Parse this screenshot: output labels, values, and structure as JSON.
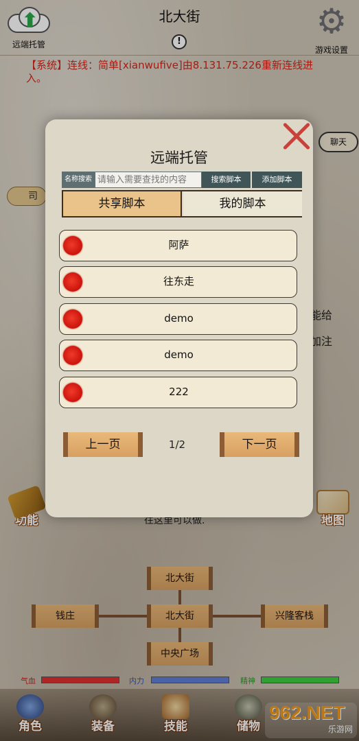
{
  "header": {
    "remote_label": "远端托管",
    "location": "北大街",
    "alert_symbol": "!",
    "settings_label": "游戏设置"
  },
  "system_message": "【系统】连线：简单[xianwufive]由8.131.75.226重新连线进入。",
  "background": {
    "chat_label": "聊天",
    "npc_tag": "司马",
    "line1": "能给",
    "line2": "加注",
    "line3": "往这里可以做.",
    "skills_label": "功能",
    "map_label": "地图"
  },
  "map": {
    "north": "北大街",
    "center": "北大街",
    "west": "钱庄",
    "east": "兴隆客栈",
    "south": "中央广场"
  },
  "stats": {
    "hp_label": "气血",
    "mp_label": "内力",
    "sp_label": "精神",
    "hp_color": "#e03030",
    "mp_color": "#5f7fd8",
    "sp_color": "#3ecf3e"
  },
  "bottom_nav": {
    "role": "角色",
    "equip": "装备",
    "skill": "技能",
    "store": "储物"
  },
  "watermark": {
    "main": "962.NET",
    "sub": "乐游网"
  },
  "modal": {
    "title": "远端托管",
    "search_tag": "名称搜索",
    "search_placeholder": "请输入需要查找的内容",
    "search_button": "搜索脚本",
    "add_button": "添加脚本",
    "tabs": [
      "共享脚本",
      "我的脚本"
    ],
    "active_tab": "共享脚本",
    "scripts": [
      {
        "name": "阿萨"
      },
      {
        "name": "往东走"
      },
      {
        "name": "demo"
      },
      {
        "name": "demo"
      },
      {
        "name": "222"
      }
    ],
    "prev_label": "上一页",
    "next_label": "下一页",
    "page_indicator": "1/2"
  },
  "colors": {
    "accent_tab": "#eac38a",
    "system_text": "#d42418",
    "status_dot": "#e0281c"
  }
}
